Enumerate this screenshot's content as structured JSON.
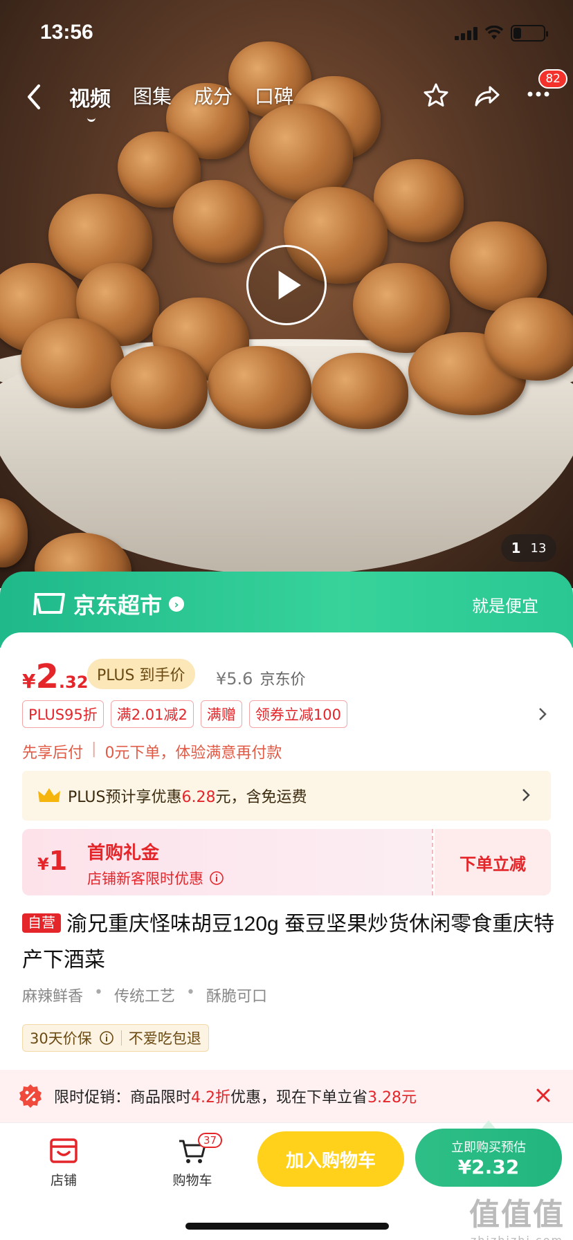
{
  "status_bar": {
    "time": "13:56"
  },
  "top_nav": {
    "tabs": [
      {
        "label": "视频",
        "active": true
      },
      {
        "label": "图集",
        "active": false
      },
      {
        "label": "成分",
        "active": false
      },
      {
        "label": "口碑",
        "active": false
      }
    ],
    "message_badge": "82"
  },
  "gallery": {
    "current": "1",
    "total": "13"
  },
  "store_banner": {
    "name": "京东超市",
    "slogan": "就是便宜"
  },
  "price": {
    "symbol": "¥",
    "integer": "2",
    "decimal": ".32",
    "plus_label": "PLUS 到手价",
    "jd_price": "¥5.6",
    "jd_price_label": "京东价"
  },
  "promo_tags": [
    "PLUS95折",
    "满2.01减2",
    "满赠",
    "领券立减100"
  ],
  "pay_later": {
    "label": "先享后付",
    "separator": "|",
    "text": "0元下单，体验满意再付款"
  },
  "plus_bar": {
    "prefix": "PLUS预计享优惠",
    "amount": "6.28",
    "suffix": "元，含免运费"
  },
  "coupon": {
    "symbol": "¥",
    "amount": "1",
    "title": "首购礼金",
    "subtitle": "店铺新客限时优惠",
    "action": "下单立减"
  },
  "product": {
    "self_tag": "自营",
    "title": "渝兄重庆怪味胡豆120g 蚕豆坚果炒货休闲零食重庆特产下酒菜",
    "features": [
      "麻辣鲜香",
      "传统工艺",
      "酥脆可口"
    ],
    "guarantee": [
      "30天价保",
      "不爱吃包退"
    ]
  },
  "flash_promo": {
    "label": "限时促销：",
    "text1": "商品限时",
    "discount": "4.2折",
    "text2": "优惠，现在下单立省",
    "saving": "3.28元"
  },
  "bottom_bar": {
    "store_label": "店铺",
    "cart_label": "购物车",
    "cart_count": "37",
    "add_to_cart": "加入购物车",
    "buy_line1": "立即购买预估",
    "buy_line2": "¥2.32"
  },
  "watermark": {
    "big": "值值值",
    "small": "zhizhizhi.com"
  },
  "colors": {
    "accent_red": "#e4252a",
    "jd_green": "#2bc793",
    "cart_yellow": "#ffd11a"
  }
}
